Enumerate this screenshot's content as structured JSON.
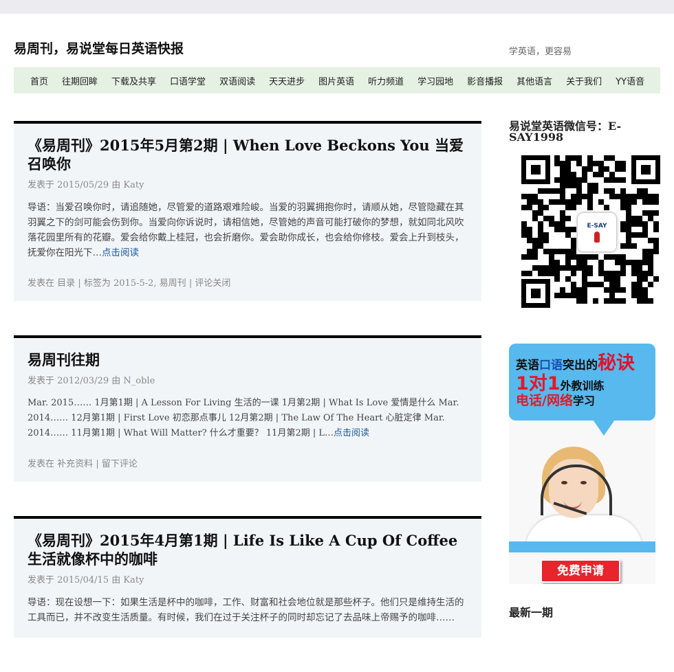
{
  "site": {
    "title": "易周刊，易说堂每日英语快报",
    "description": "学英语，更容易"
  },
  "nav": {
    "items": [
      "首页",
      "往期回眸",
      "下载及共享",
      "口语学堂",
      "双语阅读",
      "天天进步",
      "图片英语",
      "听力频道",
      "学习园地",
      "影音播报",
      "其他语言",
      "关于我们",
      "YY语音"
    ]
  },
  "posts": [
    {
      "title": "《易周刊》2015年5月第2期 | When Love Beckons You 当爱召唤你",
      "meta_prefix": "发表于",
      "date": "2015/05/29",
      "by": "由",
      "author": "Katy",
      "excerpt": "导语：当爱召唤你时，请追随她，尽管爱的道路艰难险峻。当爱的羽翼拥抱你时，请顺从她，尽管隐藏在其羽翼之下的剑可能会伤到你。当爱向你诉说时，请相信她，尽管她的声音可能打破你的梦想，就如同北风吹落花园里所有的花瓣。爱会给你戴上桂冠，也会折磨你。爱会助你成长，也会给你修枝。爱会上升到枝头，抚爱你在阳光下…",
      "read_more": "点击阅读",
      "footer_posted_in": "发表在",
      "category": "目录",
      "footer_sep1": "|",
      "footer_tags_label": "标签为",
      "tags": "2015-5-2, 易周刊",
      "footer_sep2": "|",
      "comments": "评论关闭"
    },
    {
      "title": "易周刊往期",
      "meta_prefix": "发表于",
      "date": "2012/03/29",
      "by": "由",
      "author": "N_oble",
      "excerpt": "Mar. 2015……   1月第1期  | A Lesson For Living 生活的一课  1月第2期  | What Is Love 爱情是什么  Mar. 2014……   12月第1期  | First Love 初恋那点事儿  12月第2期  | The Law Of The Heart 心脏定律  Mar. 2014……   11月第1期  | What Will Matter? 什么才重要？  11月第2期  | L…",
      "read_more": "点击阅读",
      "footer_posted_in": "发表在",
      "category": "补充资料",
      "footer_sep1": "|",
      "comments": "留下评论"
    },
    {
      "title": "《易周刊》2015年4月第1期 | Life Is Like A Cup Of Coffee 生活就像杯中的咖啡",
      "meta_prefix": "发表于",
      "date": "2015/04/15",
      "by": "由",
      "author": "Katy",
      "excerpt": "导语：现在设想一下：如果生活是杯中的咖啡，工作、财富和社会地位就是那些杯子。他们只是维持生活的工具而已，并不改变生活质量。有时候，我们在过于关注杯子的同时却忘记了去品味上帝赐予的咖啡……"
    }
  ],
  "sidebar": {
    "wechat_title": "易说堂英语微信号：E-SAY1998",
    "qr_logo_text": "E-SAY",
    "ad": {
      "line1_a": "英语",
      "line1_b": "口语",
      "line1_c": "突出的",
      "line1_d": "秘诀",
      "line2_a": "1对1",
      "line2_b": "外教训练",
      "line3_a": "电话/网络",
      "line3_b": "学习",
      "button": "免费申请"
    },
    "latest_title": "最新一期"
  },
  "colors": {
    "nav_bg": "#e5f1e3",
    "post_bg": "#f2f5f8",
    "link": "#1a5a9a",
    "ad_blue": "#57b9ee",
    "ad_red": "#e8242c"
  }
}
